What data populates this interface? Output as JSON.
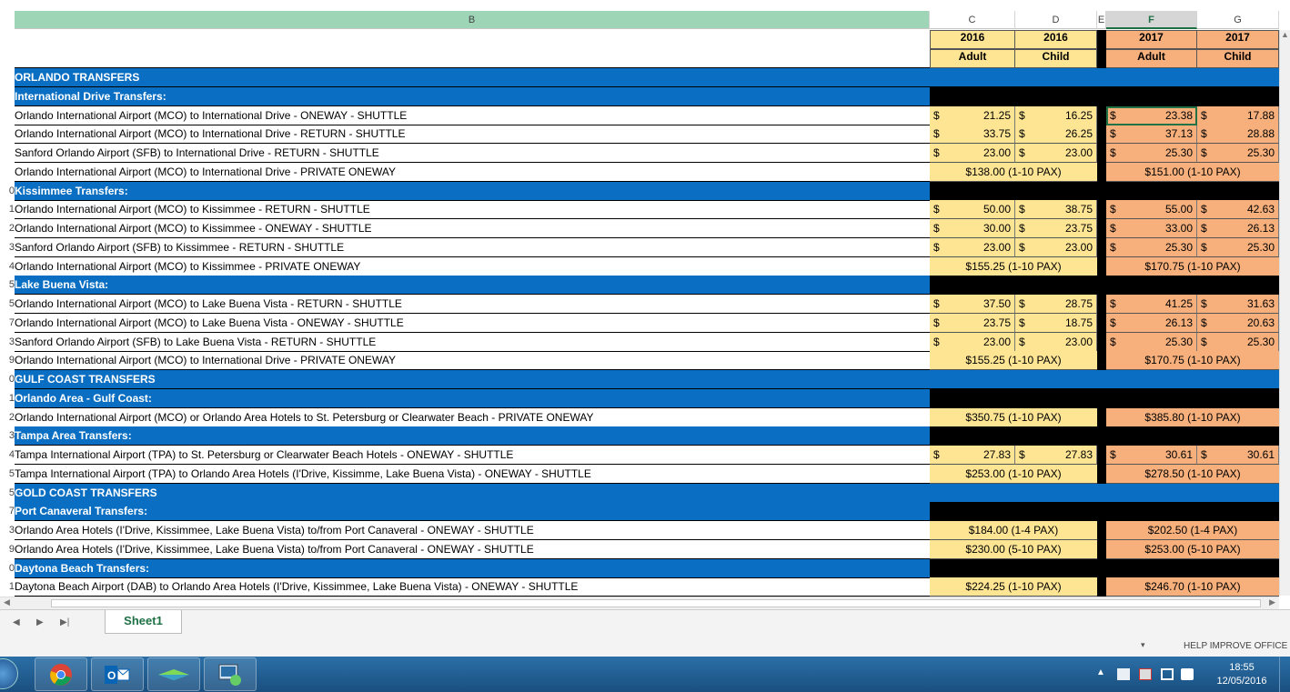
{
  "columns": {
    "b": "B",
    "c": "C",
    "d": "D",
    "e": "E",
    "f": "F",
    "g": "G"
  },
  "headers": {
    "c_year": "2016",
    "c_type": "Adult",
    "d_year": "2016",
    "d_type": "Child",
    "f_year": "2017",
    "f_type": "Adult",
    "g_year": "2017",
    "g_type": "Child"
  },
  "rows": [
    {
      "n": "",
      "kind": "section",
      "label": "ORLANDO TRANSFERS"
    },
    {
      "n": "",
      "kind": "group",
      "label": "International Drive Transfers:"
    },
    {
      "n": "",
      "kind": "money",
      "label": "Orlando International Airport (MCO) to International Drive - ONEWAY - SHUTTLE",
      "c": "21.25",
      "d": "16.25",
      "f": "23.38",
      "g": "17.88"
    },
    {
      "n": "",
      "kind": "money",
      "label": "Orlando International Airport (MCO) to International Drive - RETURN - SHUTTLE",
      "c": "33.75",
      "d": "26.25",
      "f": "37.13",
      "g": "28.88"
    },
    {
      "n": "",
      "kind": "money",
      "label": "Sanford Orlando Airport (SFB) to International Drive - RETURN - SHUTTLE",
      "c": "23.00",
      "d": "23.00",
      "f": "25.30",
      "g": "25.30"
    },
    {
      "n": "",
      "kind": "span",
      "label": "Orlando International Airport (MCO) to International Drive - PRIVATE ONEWAY",
      "y16": "$138.00 (1-10 PAX)",
      "y17": "$151.00 (1-10 PAX)"
    },
    {
      "n": "0",
      "kind": "group",
      "label": "Kissimmee Transfers:"
    },
    {
      "n": "1",
      "kind": "money",
      "label": "Orlando International Airport (MCO) to Kissimmee - RETURN - SHUTTLE",
      "c": "50.00",
      "d": "38.75",
      "f": "55.00",
      "g": "42.63"
    },
    {
      "n": "2",
      "kind": "money",
      "label": "Orlando International Airport (MCO) to Kissimmee - ONEWAY - SHUTTLE",
      "c": "30.00",
      "d": "23.75",
      "f": "33.00",
      "g": "26.13"
    },
    {
      "n": "3",
      "kind": "money",
      "label": "Sanford Orlando Airport (SFB) to Kissimmee - RETURN - SHUTTLE",
      "c": "23.00",
      "d": "23.00",
      "f": "25.30",
      "g": "25.30"
    },
    {
      "n": "4",
      "kind": "span",
      "label": "Orlando International Airport (MCO) to Kissimmee - PRIVATE ONEWAY",
      "y16": "$155.25 (1-10 PAX)",
      "y17": "$170.75 (1-10 PAX)"
    },
    {
      "n": "5",
      "kind": "group",
      "label": "Lake Buena Vista:"
    },
    {
      "n": "5",
      "kind": "money",
      "label": "Orlando International Airport (MCO) to Lake Buena Vista - RETURN - SHUTTLE",
      "c": "37.50",
      "d": "28.75",
      "f": "41.25",
      "g": "31.63"
    },
    {
      "n": "7",
      "kind": "money",
      "label": "Orlando International Airport (MCO) to Lake Buena Vista - ONEWAY - SHUTTLE",
      "c": "23.75",
      "d": "18.75",
      "f": "26.13",
      "g": "20.63"
    },
    {
      "n": "3",
      "kind": "money",
      "label": "Sanford Orlando Airport (SFB) to Lake Buena Vista - RETURN - SHUTTLE",
      "c": "23.00",
      "d": "23.00",
      "f": "25.30",
      "g": "25.30"
    },
    {
      "n": "9",
      "kind": "span",
      "label": "Orlando International Airport (MCO) to International Drive - PRIVATE ONEWAY",
      "y16": "$155.25 (1-10 PAX)",
      "y17": "$170.75 (1-10 PAX)"
    },
    {
      "n": "0",
      "kind": "section",
      "label": "GULF COAST TRANSFERS"
    },
    {
      "n": "1",
      "kind": "group",
      "label": "Orlando Area - Gulf Coast:"
    },
    {
      "n": "2",
      "kind": "span",
      "label": "Orlando International Airport (MCO) or Orlando Area Hotels to St. Petersburg or Clearwater Beach - PRIVATE ONEWAY",
      "y16": "$350.75 (1-10 PAX)",
      "y17": "$385.80 (1-10 PAX)"
    },
    {
      "n": "3",
      "kind": "group",
      "label": "Tampa Area Transfers:"
    },
    {
      "n": "4",
      "kind": "money",
      "label": "Tampa International Airport (TPA) to St. Petersburg or Clearwater Beach Hotels - ONEWAY - SHUTTLE",
      "c": "27.83",
      "d": "27.83",
      "f": "30.61",
      "g": "30.61"
    },
    {
      "n": "5",
      "kind": "span",
      "label": "Tampa International Airport (TPA) to Orlando Area Hotels (I'Drive, Kissimme, Lake Buena Vista) - ONEWAY - SHUTTLE",
      "y16": "$253.00 (1-10 PAX)",
      "y17": "$278.50 (1-10 PAX)"
    },
    {
      "n": "5",
      "kind": "section",
      "label": "GOLD COAST TRANSFERS"
    },
    {
      "n": "7",
      "kind": "group",
      "label": "Port Canaveral Transfers:"
    },
    {
      "n": "3",
      "kind": "span",
      "label": "Orlando Area Hotels (I'Drive, Kissimmee, Lake Buena Vista) to/from Port Canaveral - ONEWAY - SHUTTLE",
      "y16": "$184.00 (1-4 PAX)",
      "y17": "$202.50 (1-4 PAX)"
    },
    {
      "n": "9",
      "kind": "span",
      "label": "Orlando Area Hotels (I'Drive, Kissimmee, Lake Buena Vista) to/from Port Canaveral - ONEWAY - SHUTTLE",
      "y16": "$230.00 (5-10 PAX)",
      "y17": "$253.00 (5-10 PAX)"
    },
    {
      "n": "0",
      "kind": "group",
      "label": "Daytona Beach Transfers:"
    },
    {
      "n": "1",
      "kind": "span",
      "label": "Daytona Beach Airport (DAB) to Orlando Area Hotels (I'Drive, Kissimmee, Lake Buena Vista) - ONEWAY - SHUTTLE",
      "y16": "$224.25 (1-10 PAX)",
      "y17": "$246.70 (1-10 PAX)"
    }
  ],
  "currency_symbol": "$",
  "sheet_tab": "Sheet1",
  "status_text": "HELP IMPROVE OFFICE",
  "clock": {
    "time": "18:55",
    "date": "12/05/2016"
  },
  "icons": {
    "chrome": "chrome-icon",
    "outlook": "outlook-icon",
    "explorer": "explorer-icon",
    "remote": "remote-icon"
  }
}
